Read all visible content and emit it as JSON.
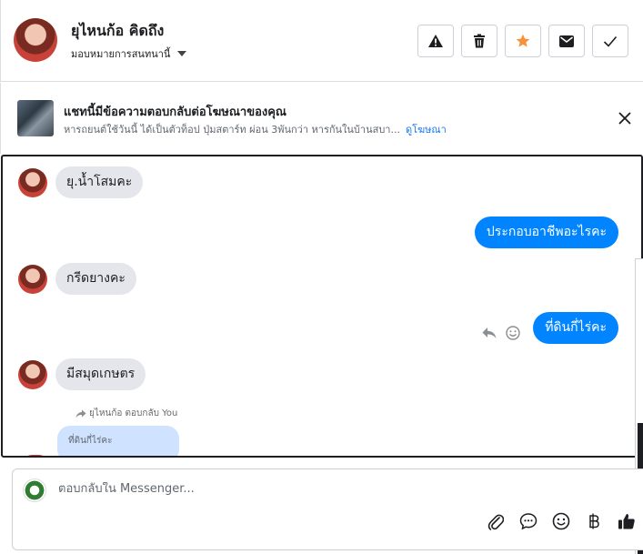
{
  "header": {
    "contact_name": "ยุไหนก้อ คิดถึง",
    "assign_label": "มอบหมายการสนทนานี้",
    "actions": [
      {
        "name": "mark-spam",
        "icon": "warning-icon"
      },
      {
        "name": "delete",
        "icon": "trash-icon"
      },
      {
        "name": "star",
        "icon": "star-icon",
        "color": "#f7923a"
      },
      {
        "name": "mark-unread",
        "icon": "envelope-icon"
      },
      {
        "name": "mark-done",
        "icon": "check-icon"
      }
    ]
  },
  "ad_banner": {
    "title": "แชทนี้มีข้อความตอบกลับต่อโฆษณาของคุณ",
    "subtitle": "หารถยนต์ใช้วันนี้ ได้เป็นตัวท็อป ปุ่มสตาร์ท ผ่อน 3พันกว่า หารกันในบ้านสบา...",
    "link_label": "ดูโฆษณา"
  },
  "messages": [
    {
      "direction": "in",
      "text": "ยุ.น้ำโสมคะ"
    },
    {
      "direction": "out",
      "text": "ประกอบอาชีพอะไรคะ"
    },
    {
      "direction": "in",
      "text": "กรีดยางคะ"
    },
    {
      "direction": "out",
      "text": "ที่ดินกี่ไร่คะ"
    },
    {
      "direction": "in",
      "text": "มีสมุดเกษตร"
    }
  ],
  "reply": {
    "note": "ยุไหนก้อ ตอบกลับ You",
    "quoted_text": "ที่ดินกี่ไร่คะ"
  },
  "composer": {
    "placeholder": "ตอบกลับใน Messenger...",
    "tools": [
      "paperclip-icon",
      "chat-bubble-icon",
      "emoji-icon",
      "baht-icon",
      "thumbs-up-icon"
    ]
  },
  "colors": {
    "accent": "#0084ff",
    "link": "#1877f2",
    "incoming_bubble": "#e4e6eb",
    "quoted_bubble": "#cfe2ff"
  }
}
